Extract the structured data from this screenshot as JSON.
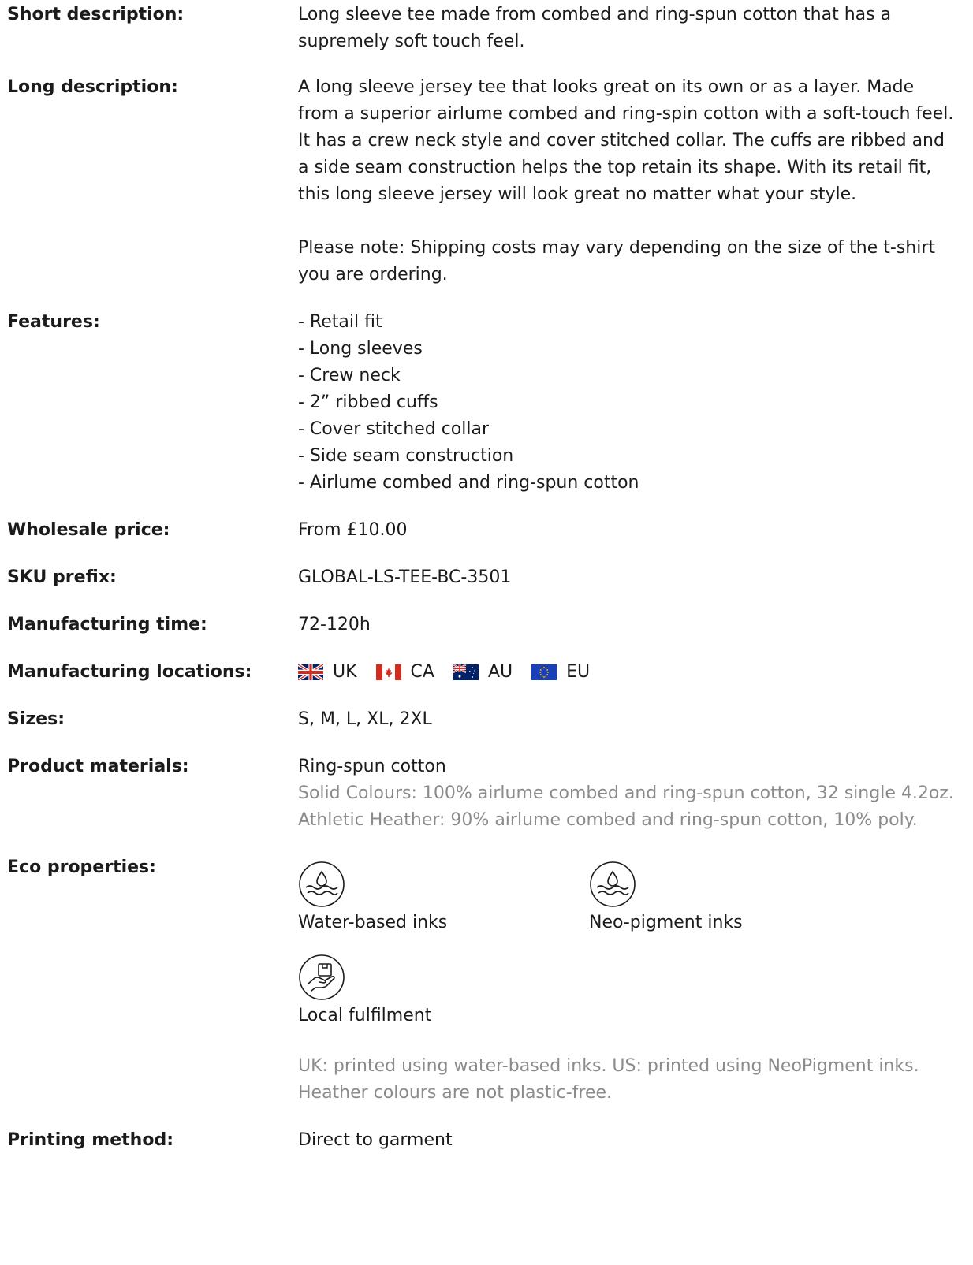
{
  "fields": {
    "short_description": {
      "label": "Short description:",
      "value": "Long sleeve tee made from combed and ring-spun cotton that has a supremely soft touch feel."
    },
    "long_description": {
      "label": "Long description:",
      "paragraph_1": "A long sleeve jersey tee that looks great on its own or as a layer. Made from a superior airlume combed and ring-spin cotton with a soft-touch feel. It has a crew neck style and cover stitched collar. The cuffs are ribbed and a side seam construction helps the top retain its shape. With its retail fit, this long sleeve jersey will look great no matter what your style.",
      "paragraph_2": "Please note: Shipping costs may vary depending on the size of the t-shirt you are ordering."
    },
    "features": {
      "label": "Features:",
      "items": [
        "- Retail fit",
        "- Long sleeves",
        "- Crew neck",
        "- 2” ribbed cuffs",
        "- Cover stitched collar",
        "- Side seam construction",
        "- Airlume combed and ring-spun cotton"
      ]
    },
    "wholesale_price": {
      "label": "Wholesale price:",
      "value": "From £10.00"
    },
    "sku_prefix": {
      "label": "SKU prefix:",
      "value": "GLOBAL-LS-TEE-BC-3501"
    },
    "manufacturing_time": {
      "label": "Manufacturing time:",
      "value": "72-120h"
    },
    "manufacturing_locations": {
      "label": "Manufacturing locations:",
      "items": [
        {
          "code": "UK",
          "flag": "uk-flag-icon"
        },
        {
          "code": "CA",
          "flag": "canada-flag-icon"
        },
        {
          "code": "AU",
          "flag": "australia-flag-icon"
        },
        {
          "code": "EU",
          "flag": "eu-flag-icon"
        }
      ]
    },
    "sizes": {
      "label": "Sizes:",
      "value": "S, M, L, XL, 2XL"
    },
    "product_materials": {
      "label": "Product materials:",
      "value": "Ring-spun cotton",
      "solid": "Solid Colours: 100% airlume combed and ring-spun cotton, 32 single 4.2oz.",
      "heather": "Athletic Heather: 90% airlume combed and ring-spun cotton, 10% poly."
    },
    "eco_properties": {
      "label": "Eco properties:",
      "items": [
        {
          "label": "Water-based inks",
          "icon": "water-drop-icon"
        },
        {
          "label": "Neo-pigment inks",
          "icon": "water-drop-icon"
        },
        {
          "label": "Local fulfilment",
          "icon": "hand-package-icon"
        }
      ],
      "note": "UK: printed using water-based inks. US: printed using NeoPigment inks. Heather colours are not plastic-free."
    },
    "printing_method": {
      "label": "Printing method:",
      "value": "Direct to garment"
    }
  },
  "colors": {
    "text": "#1b1b1b",
    "muted": "#8b8b8b",
    "flag_red": "#d52b1e",
    "flag_navy": "#012169",
    "eu_blue": "#1a3fb8",
    "eu_gold": "#ffcc00"
  }
}
